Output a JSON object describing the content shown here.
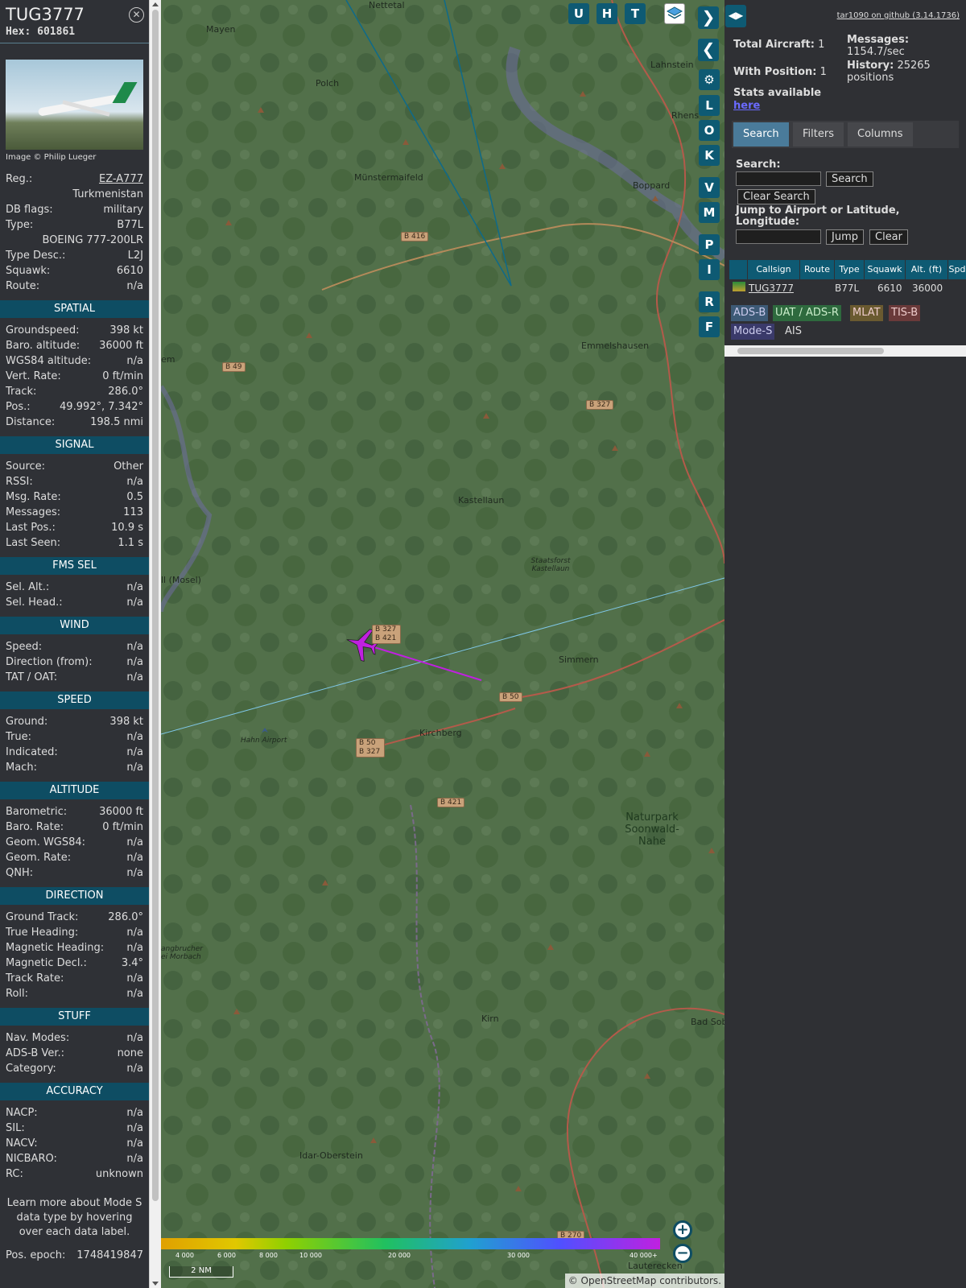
{
  "info": {
    "callsign": "TUG3777",
    "hex_label": "Hex:",
    "hex": "601861",
    "close_icon": "close-icon",
    "image_credit": "Image © Philip Lueger",
    "general": [
      {
        "k": "Reg.:",
        "v": "EZ-A777"
      },
      {
        "k": "",
        "v": "Turkmenistan"
      },
      {
        "k": "DB flags:",
        "v": "military"
      },
      {
        "k": "Type:",
        "v": "B77L"
      },
      {
        "k": "",
        "v": "BOEING 777-200LR"
      },
      {
        "k": "Type Desc.:",
        "v": "L2J"
      },
      {
        "k": "Squawk:",
        "v": "6610"
      },
      {
        "k": "Route:",
        "v": "n/a"
      }
    ],
    "sections": [
      {
        "title": "SPATIAL",
        "rows": [
          {
            "k": "Groundspeed:",
            "v": "398 kt"
          },
          {
            "k": "Baro. altitude:",
            "v": "36000 ft"
          },
          {
            "k": "WGS84 altitude:",
            "v": "n/a"
          },
          {
            "k": "Vert. Rate:",
            "v": "0 ft/min"
          },
          {
            "k": "Track:",
            "v": "286.0°"
          },
          {
            "k": "Pos.:",
            "v": "49.992°, 7.342°"
          },
          {
            "k": "Distance:",
            "v": "198.5 nmi"
          }
        ]
      },
      {
        "title": "SIGNAL",
        "rows": [
          {
            "k": "Source:",
            "v": "Other"
          },
          {
            "k": "RSSI:",
            "v": "n/a"
          },
          {
            "k": "Msg. Rate:",
            "v": "0.5"
          },
          {
            "k": "Messages:",
            "v": "113"
          },
          {
            "k": "Last Pos.:",
            "v": "10.9 s"
          },
          {
            "k": "Last Seen:",
            "v": "1.1 s"
          }
        ]
      },
      {
        "title": "FMS SEL",
        "rows": [
          {
            "k": "Sel. Alt.:",
            "v": "n/a"
          },
          {
            "k": "Sel. Head.:",
            "v": "n/a"
          }
        ]
      },
      {
        "title": "WIND",
        "rows": [
          {
            "k": "Speed:",
            "v": "n/a"
          },
          {
            "k": "Direction (from):",
            "v": "n/a"
          },
          {
            "k": "TAT / OAT:",
            "v": "n/a"
          }
        ]
      },
      {
        "title": "SPEED",
        "rows": [
          {
            "k": "Ground:",
            "v": "398 kt"
          },
          {
            "k": "True:",
            "v": "n/a"
          },
          {
            "k": "Indicated:",
            "v": "n/a"
          },
          {
            "k": "Mach:",
            "v": "n/a"
          }
        ]
      },
      {
        "title": "ALTITUDE",
        "rows": [
          {
            "k": "Barometric:",
            "v": "36000 ft"
          },
          {
            "k": "Baro. Rate:",
            "v": "0 ft/min"
          },
          {
            "k": "Geom. WGS84:",
            "v": "n/a"
          },
          {
            "k": "Geom. Rate:",
            "v": "n/a"
          },
          {
            "k": "QNH:",
            "v": "n/a"
          }
        ]
      },
      {
        "title": "DIRECTION",
        "rows": [
          {
            "k": "Ground Track:",
            "v": "286.0°"
          },
          {
            "k": "True Heading:",
            "v": "n/a"
          },
          {
            "k": "Magnetic Heading:",
            "v": "n/a"
          },
          {
            "k": "Magnetic Decl.:",
            "v": "3.4°"
          },
          {
            "k": "Track Rate:",
            "v": "n/a"
          },
          {
            "k": "Roll:",
            "v": "n/a"
          }
        ]
      },
      {
        "title": "STUFF",
        "rows": [
          {
            "k": "Nav. Modes:",
            "v": "n/a"
          },
          {
            "k": "ADS-B Ver.:",
            "v": "none"
          },
          {
            "k": "Category:",
            "v": "n/a"
          }
        ]
      },
      {
        "title": "ACCURACY",
        "rows": [
          {
            "k": "NACP:",
            "v": "n/a"
          },
          {
            "k": "SIL:",
            "v": "n/a"
          },
          {
            "k": "NACV:",
            "v": "n/a"
          },
          {
            "k": "NICBARO:",
            "v": "n/a"
          },
          {
            "k": "RC:",
            "v": "unknown"
          }
        ]
      }
    ],
    "learn_more": "Learn more about Mode S data type by hovering over each data label.",
    "epoch_label": "Pos. epoch:",
    "epoch": "1748419847"
  },
  "map": {
    "places": [
      "Nettetal",
      "Mayen",
      "Polch",
      "Lahnstein",
      "Rhens",
      "Münstermaifeld",
      "Boppard",
      "Emmelshausen",
      "Kastellaun",
      "Staatsforst Kastellaun",
      "Simmern",
      "Kirchberg",
      "Hahn Airport",
      "Naturpark Soonwald-Nahe",
      "Kirn",
      "Bad Sob",
      "Idar-Oberstein",
      "Lauterecken",
      "ll (Mosel)",
      "em",
      "angbrucher ei Morbach"
    ],
    "roads": [
      "B 416",
      "B 49",
      "B 327",
      "B 327 B 421",
      "B 50",
      "B 50 B 327",
      "B 421",
      "B 270"
    ],
    "toolbar": [
      "U",
      "H",
      "T"
    ],
    "layers_icon": "layers-icon",
    "right_buttons": [
      "L",
      "O",
      "K",
      "V",
      "M",
      "P",
      "I",
      "R",
      "F"
    ],
    "legend_ticks": [
      "4 000",
      "6 000",
      "8 000",
      "10 000",
      "20 000",
      "30 000",
      "40 000+"
    ],
    "scale": "2 NM",
    "attribution_prefix": "© ",
    "attribution_link": "OpenStreetMap",
    "attribution_suffix": " contributors.",
    "track_color": "#c020e0"
  },
  "sidebar": {
    "github": "tar1090 on github (3.14.1736)",
    "total_aircraft_label": "Total Aircraft:",
    "total_aircraft": "1",
    "with_position_label": "With Position:",
    "with_position": "1",
    "stats_text": "Stats available",
    "stats_link": "here",
    "messages_label": "Messages:",
    "messages_rate": "1154.7/sec",
    "history_label": "History:",
    "history_value": "25265",
    "history_unit": "positions",
    "tabs": [
      "Search",
      "Filters",
      "Columns"
    ],
    "search_label": "Search:",
    "search_button": "Search",
    "clear_search": "Clear Search",
    "jump_label": "Jump to Airport or Latitude, Longitude:",
    "jump_button": "Jump",
    "clear_button": "Clear",
    "columns": [
      "Callsign",
      "Route",
      "Type",
      "Squawk",
      "Alt. (ft)",
      "Spd"
    ],
    "row": {
      "callsign": "TUG3777",
      "type": "B77L",
      "squawk": "6610",
      "alt": "36000"
    },
    "sources": [
      "ADS-B",
      "UAT / ADS-R",
      "MLAT",
      "TIS-B",
      "Mode-S",
      "AIS"
    ]
  }
}
